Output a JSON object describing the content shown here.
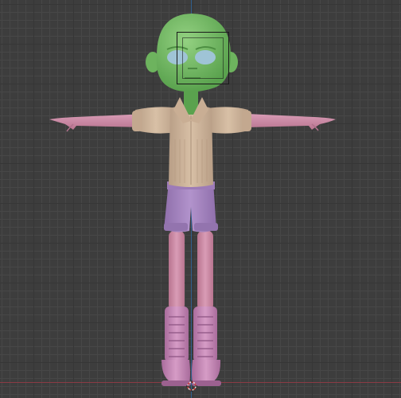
{
  "viewport": {
    "grid_color": "#363636",
    "subgrid_color": "#474747",
    "background_color": "#3d3d3d",
    "x_axis_color": "#8a3b44",
    "z_axis_color": "#2f5e8c"
  },
  "character": {
    "skin_color": "#7fbf6e",
    "eye_color": "#9fc4d6",
    "shirt_color": "#cdb39a",
    "shorts_color": "#a585c0",
    "legs_arms_color": "#d08aa8",
    "boots_color": "#c98ab8",
    "icon": "t-pose-character"
  },
  "camera_frame": {
    "icon": "camera-view-frame"
  },
  "origin_cursor": {
    "icon": "3d-cursor-icon"
  }
}
